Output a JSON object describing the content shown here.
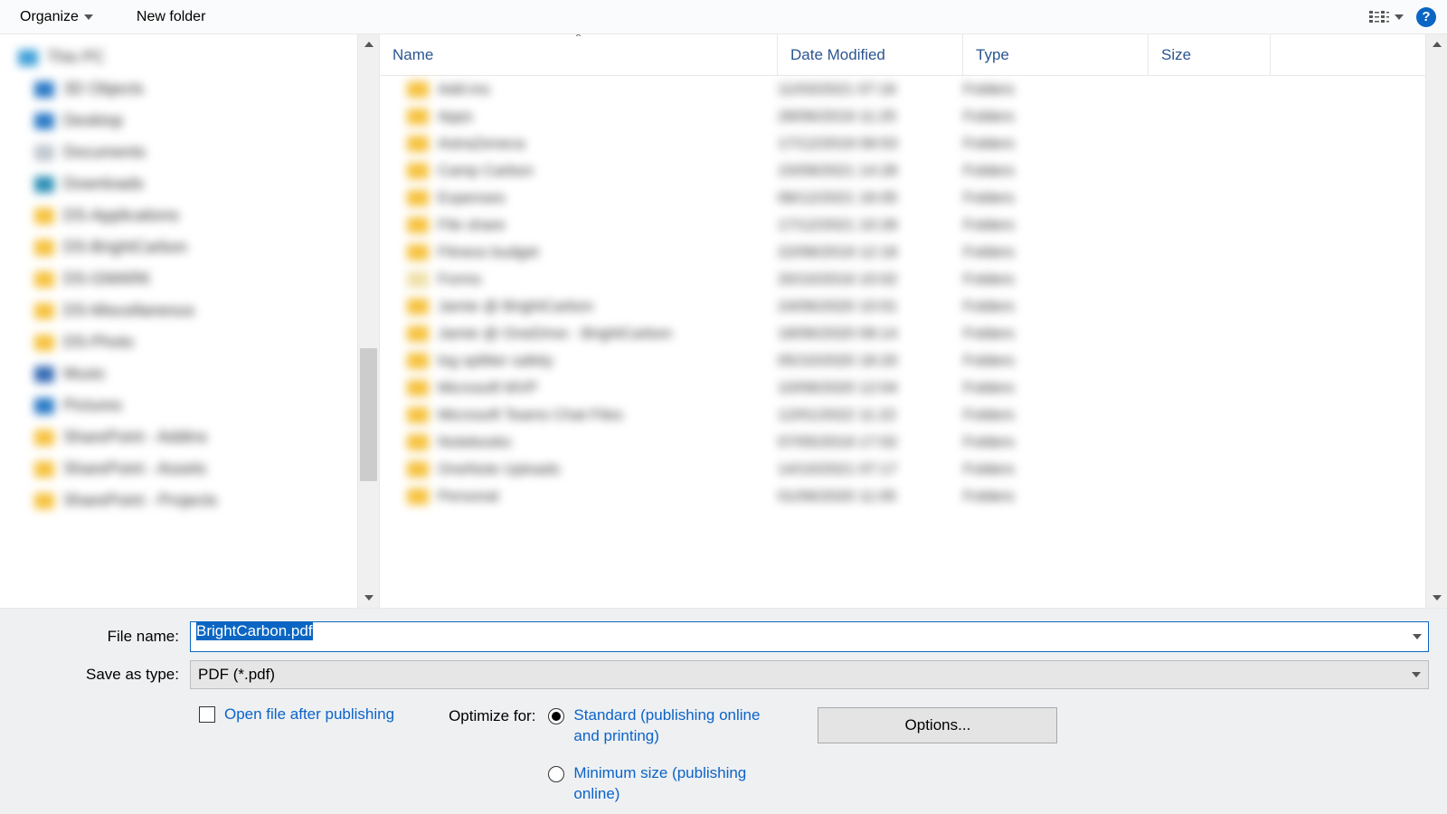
{
  "toolbar": {
    "organize": "Organize",
    "new_folder": "New folder"
  },
  "columns": {
    "name": "Name",
    "date": "Date Modified",
    "type": "Type",
    "size": "Size"
  },
  "nav": [
    {
      "label": "This PC",
      "color": "pc",
      "root": true
    },
    {
      "label": "3D Objects",
      "color": "blue"
    },
    {
      "label": "Desktop",
      "color": "blue"
    },
    {
      "label": "Documents",
      "color": "gray"
    },
    {
      "label": "Downloads",
      "color": "teal"
    },
    {
      "label": "DS-Applications",
      "color": "yellow"
    },
    {
      "label": "DS-BrightCarbon",
      "color": "yellow"
    },
    {
      "label": "DS-GMARK",
      "color": "yellow"
    },
    {
      "label": "DS-Miscellaneous",
      "color": "yellow"
    },
    {
      "label": "DS-Photo",
      "color": "yellow"
    },
    {
      "label": "Music",
      "color": "music"
    },
    {
      "label": "Pictures",
      "color": "blue"
    },
    {
      "label": "SharePoint - Addins",
      "color": "yellow"
    },
    {
      "label": "SharePoint - Assets",
      "color": "yellow"
    },
    {
      "label": "SharePoint - Projects",
      "color": "yellow"
    }
  ],
  "files": [
    {
      "name": "Add-ins",
      "date": "11/03/2021 07:16",
      "type": "Folders"
    },
    {
      "name": "Apps",
      "date": "28/06/2019 11:25",
      "type": "Folders"
    },
    {
      "name": "AstraZeneca",
      "date": "17/12/2019 09:53",
      "type": "Folders"
    },
    {
      "name": "Camp Carbon",
      "date": "15/09/2021 14:28",
      "type": "Folders"
    },
    {
      "name": "Expenses",
      "date": "08/12/2021 16:05",
      "type": "Folders"
    },
    {
      "name": "File share",
      "date": "17/12/2021 10:28",
      "type": "Folders"
    },
    {
      "name": "Fitness budget",
      "date": "22/08/2019 12:18",
      "type": "Folders"
    },
    {
      "name": "Forms",
      "date": "20/10/2019 10:02",
      "type": "Folders",
      "light": true
    },
    {
      "name": "Jamie @ BrightCarbon",
      "date": "24/06/2020 10:01",
      "type": "Folders"
    },
    {
      "name": "Jamie @ OneDrive - BrightCarbon",
      "date": "18/06/2020 09:14",
      "type": "Folders"
    },
    {
      "name": "log splitter safety",
      "date": "05/10/2020 18:20",
      "type": "Folders"
    },
    {
      "name": "Microsoft MVP",
      "date": "10/09/2020 12:04",
      "type": "Folders"
    },
    {
      "name": "Microsoft Teams Chat Files",
      "date": "12/01/2022 11:22",
      "type": "Folders"
    },
    {
      "name": "Notebooks",
      "date": "07/05/2019 17:02",
      "type": "Folders"
    },
    {
      "name": "OneNote Uploads",
      "date": "14/10/2021 07:17",
      "type": "Folders"
    },
    {
      "name": "Personal",
      "date": "01/06/2020 11:05",
      "type": "Folders"
    }
  ],
  "form": {
    "file_name_label": "File name:",
    "file_name_value": "BrightCarbon.pdf",
    "save_type_label": "Save as type:",
    "save_type_value": "PDF (*.pdf)",
    "open_after": "Open file after publishing",
    "optimize_label": "Optimize for:",
    "opt_standard": "Standard (publishing online and printing)",
    "opt_min": "Minimum size (publishing online)",
    "options_btn": "Options..."
  }
}
